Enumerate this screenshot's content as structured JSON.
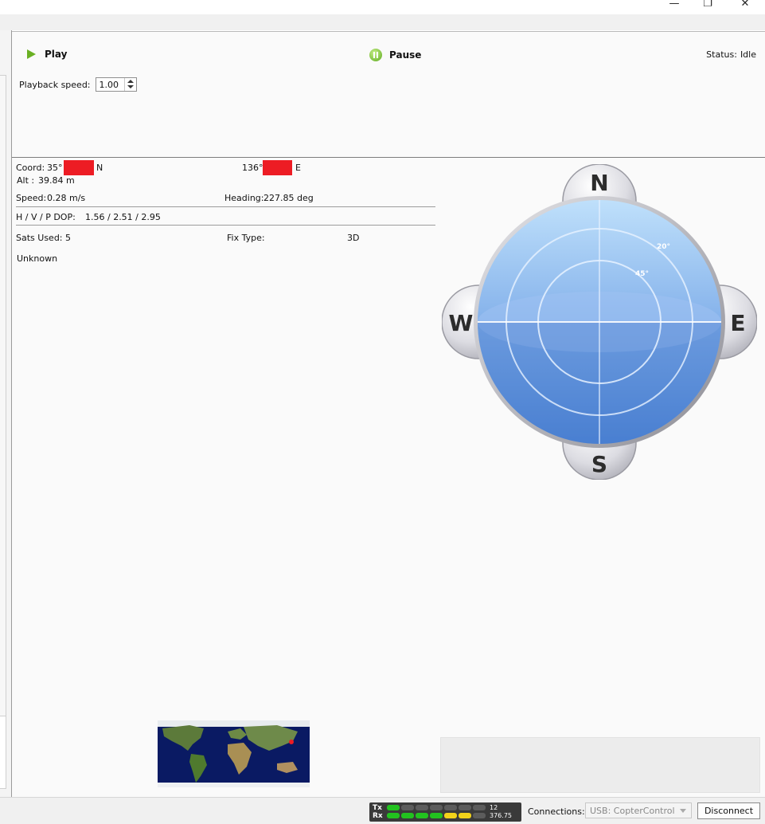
{
  "window": {
    "minimize_glyph": "—",
    "restore_glyph": "❐",
    "close_glyph": "✕"
  },
  "playback": {
    "play_label": "Play",
    "pause_label": "Pause",
    "status_label": "Status:",
    "status_value": "Idle",
    "speed_label": "Playback speed:",
    "speed_value": "1.00"
  },
  "gps": {
    "coord_label": "Coord:",
    "lat_deg": "35°",
    "lat_hemi": "N",
    "lon_deg": "136°",
    "lon_hemi": "E",
    "alt_label": "Alt :",
    "alt_value": "39.84 m",
    "speed_label": "Speed:",
    "speed_value": "0.28 m/s",
    "heading_label": "Heading:",
    "heading_value": "227.85 deg",
    "dop_label": "H / V / P DOP:",
    "dop_value": "1.56 / 2.51 / 2.95",
    "sats_label": "Sats Used:",
    "sats_value": "5",
    "fix_label": "Fix Type:",
    "fix_value": "3D",
    "extra_status": "Unknown"
  },
  "compass": {
    "north": "N",
    "south": "S",
    "east": "E",
    "west": "W",
    "ring_outer_label": "20°",
    "ring_inner_label": "45°"
  },
  "statusbar": {
    "tx_label": "Tx",
    "rx_label": "Rx",
    "tx_value": "12",
    "rx_value": "376.75",
    "tx_leds": [
      "green",
      "off",
      "off",
      "off",
      "off",
      "off",
      "off"
    ],
    "rx_leds": [
      "green",
      "green",
      "green",
      "green",
      "yellow",
      "yellow",
      "off"
    ],
    "connections_label": "Connections:",
    "connection_value": "USB: CopterControl",
    "disconnect_label": "Disconnect"
  },
  "colors": {
    "led_green": "#22c21f",
    "led_yellow": "#f2d21a",
    "led_off": "#5c5c5c",
    "redaction": "#ed1c24",
    "play_green": "#6ab023"
  }
}
